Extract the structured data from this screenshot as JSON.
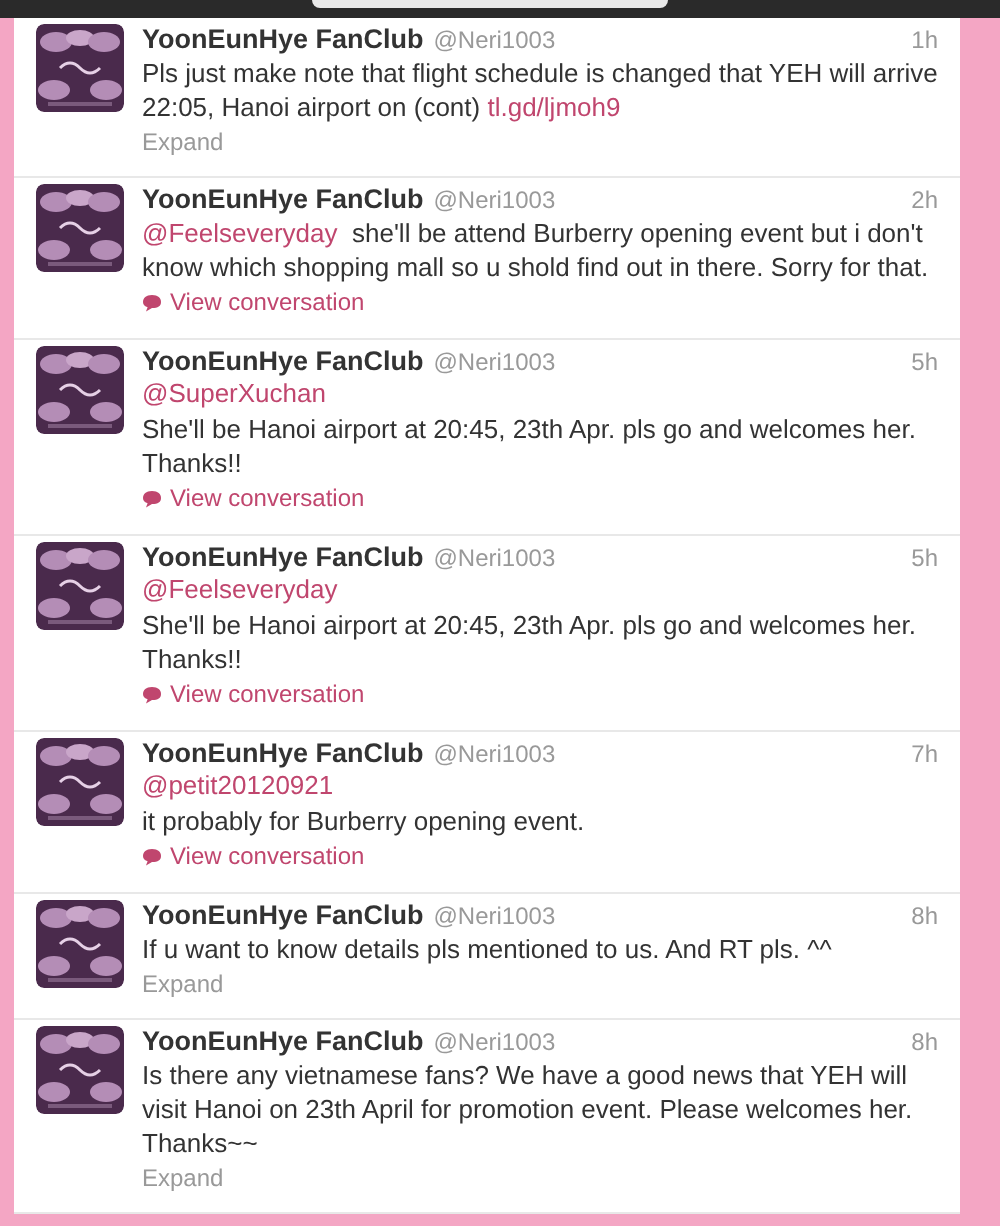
{
  "tweets": [
    {
      "name": "YoonEunHye FanClub",
      "handle": "@Neri1003",
      "time": "1h",
      "text": "Pls just make note that flight schedule is changed that YEH will arrive 22:05, Hanoi airport on (cont)",
      "link": "tl.gd/ljmoh9",
      "action": {
        "kind": "expand",
        "label": "Expand"
      }
    },
    {
      "name": "YoonEunHye FanClub",
      "handle": "@Neri1003",
      "time": "2h",
      "mention": "@Feelseveryday",
      "mention_own_line": false,
      "text": "she'll be attend Burberry opening event but i don't know which shopping mall so u shold find out in there. Sorry for that.",
      "action": {
        "kind": "conversation",
        "label": "View conversation"
      }
    },
    {
      "name": "YoonEunHye FanClub",
      "handle": "@Neri1003",
      "time": "5h",
      "mention": "@SuperXuchan",
      "mention_own_line": true,
      "text": "She'll be Hanoi airport at 20:45, 23th Apr. pls go and welcomes her. Thanks!!",
      "action": {
        "kind": "conversation",
        "label": "View conversation"
      }
    },
    {
      "name": "YoonEunHye FanClub",
      "handle": "@Neri1003",
      "time": "5h",
      "mention": "@Feelseveryday",
      "mention_own_line": true,
      "text": "She'll be Hanoi airport at 20:45, 23th Apr. pls go and welcomes her. Thanks!!",
      "action": {
        "kind": "conversation",
        "label": "View conversation"
      }
    },
    {
      "name": "YoonEunHye FanClub",
      "handle": "@Neri1003",
      "time": "7h",
      "mention": "@petit20120921",
      "mention_own_line": true,
      "text": "it probably for Burberry opening event.",
      "action": {
        "kind": "conversation",
        "label": "View conversation"
      }
    },
    {
      "name": "YoonEunHye FanClub",
      "handle": "@Neri1003",
      "time": "8h",
      "text": "If u want to know details pls mentioned to us. And RT pls. ^^",
      "action": {
        "kind": "expand",
        "label": "Expand"
      }
    },
    {
      "name": "YoonEunHye FanClub",
      "handle": "@Neri1003",
      "time": "8h",
      "text": "Is there any vietnamese fans? We have a good news that YEH will visit Hanoi on 23th April for promotion event. Please welcomes her. Thanks~~",
      "action": {
        "kind": "expand",
        "label": "Expand"
      }
    }
  ]
}
